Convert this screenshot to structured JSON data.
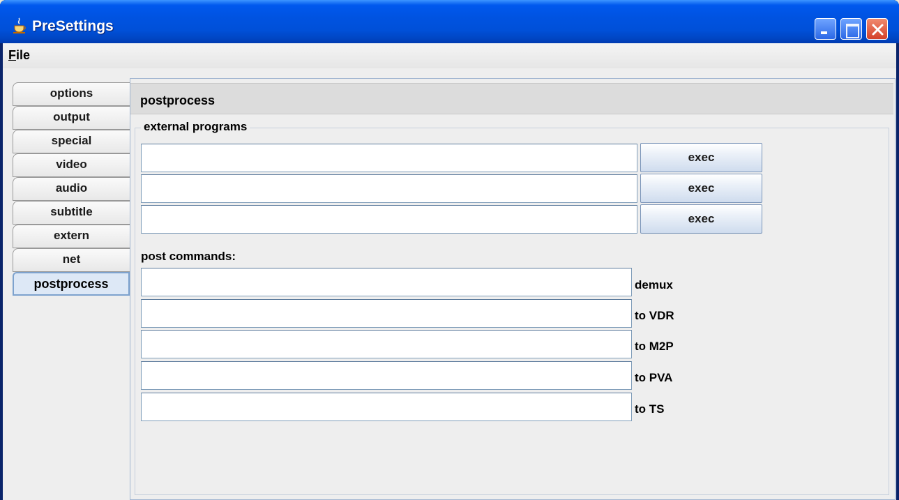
{
  "window": {
    "title": "PreSettings"
  },
  "menubar": {
    "file_label": "File",
    "file_mnemonic": "F",
    "file_rest": "ile"
  },
  "tabs": [
    {
      "label": "options"
    },
    {
      "label": "output"
    },
    {
      "label": "special"
    },
    {
      "label": "video"
    },
    {
      "label": "audio"
    },
    {
      "label": "subtitle"
    },
    {
      "label": "extern"
    },
    {
      "label": "net"
    },
    {
      "label": "postprocess",
      "selected": true
    }
  ],
  "panel": {
    "title": "postprocess",
    "external_programs": {
      "legend": "external programs",
      "rows": [
        {
          "value": "",
          "button": "exec"
        },
        {
          "value": "",
          "button": "exec"
        },
        {
          "value": "",
          "button": "exec"
        }
      ]
    },
    "post_commands": {
      "label": "post commands:",
      "rows": [
        {
          "value": "",
          "label": "demux"
        },
        {
          "value": "",
          "label": "to VDR"
        },
        {
          "value": "",
          "label": "to M2P"
        },
        {
          "value": "",
          "label": "to PVA"
        },
        {
          "value": "",
          "label": "to TS"
        }
      ]
    }
  },
  "colors": {
    "titlebar": "#0054e3",
    "selected_tab": "#dde8f6",
    "close_button": "#d4412a"
  }
}
